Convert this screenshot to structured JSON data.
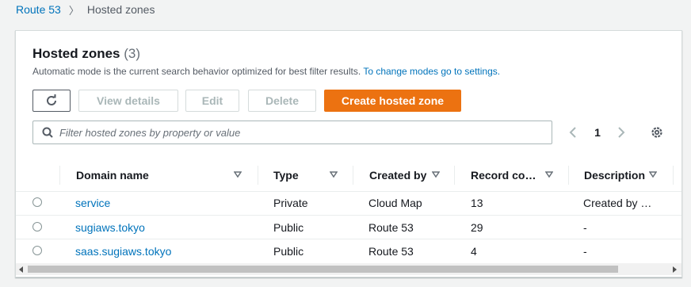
{
  "breadcrumb": {
    "root": "Route 53",
    "separator": "〉",
    "current": "Hosted zones"
  },
  "panel": {
    "title": "Hosted zones",
    "count": "(3)",
    "description": "Automatic mode is the current search behavior optimized for best filter results.",
    "description_link": "To change modes go to settings."
  },
  "toolbar": {
    "view_details": "View details",
    "edit": "Edit",
    "delete": "Delete",
    "create": "Create hosted zone"
  },
  "search": {
    "placeholder": "Filter hosted zones by property or value"
  },
  "pagination": {
    "current_page": "1"
  },
  "table": {
    "columns": [
      "Domain name",
      "Type",
      "Created by",
      "Record co…",
      "Description"
    ],
    "rows": [
      [
        "service",
        "Private",
        "Cloud Map",
        "13",
        "Created by …"
      ],
      [
        "sugiaws.tokyo",
        "Public",
        "Route 53",
        "29",
        "-"
      ],
      [
        "saas.sugiaws.tokyo",
        "Public",
        "Route 53",
        "4",
        "-"
      ]
    ]
  },
  "colors": {
    "accent": "#ec7211",
    "link": "#0073bb"
  },
  "icons": [
    "refresh-icon",
    "search-icon",
    "chevron-left-icon",
    "chevron-right-icon",
    "gear-icon",
    "sort-caret-icon"
  ]
}
